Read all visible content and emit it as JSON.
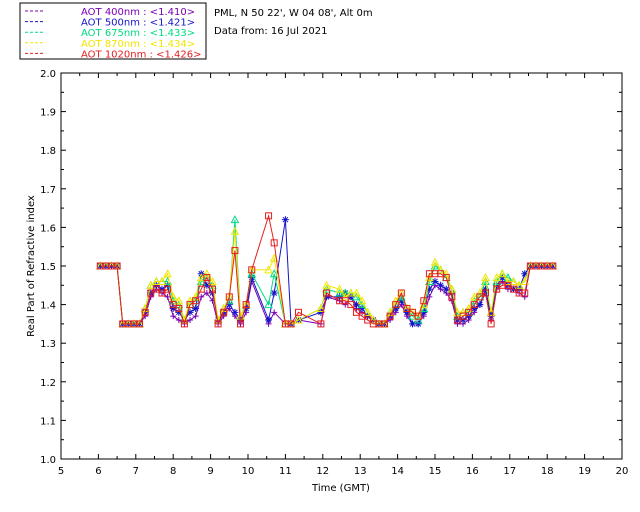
{
  "chart_data": {
    "type": "line",
    "info_lines": [
      "PML, N 50 22', W 04 08', Alt 0m",
      "Data from: 16 Jul 2021"
    ],
    "xlabel": "Time (GMT)",
    "ylabel": "Real Part of Refractive index",
    "xlim": [
      5,
      20
    ],
    "ylim": [
      1.0,
      2.0
    ],
    "xticks": [
      5,
      6,
      7,
      8,
      9,
      10,
      11,
      12,
      13,
      14,
      15,
      16,
      17,
      18,
      19,
      20
    ],
    "yticks": [
      "1.0",
      "1.1",
      "1.2",
      "1.3",
      "1.4",
      "1.5",
      "1.6",
      "1.7",
      "1.8",
      "1.9",
      "2.0"
    ],
    "grid": false,
    "legend_position": "top-left",
    "series": [
      {
        "name": "AOT 400nm : <1.410>",
        "color": "#7b00b4",
        "marker": "plus",
        "x": [
          6.05,
          6.2,
          6.35,
          6.5,
          6.65,
          6.8,
          6.95,
          7.1,
          7.25,
          7.4,
          7.55,
          7.7,
          7.85,
          8.0,
          8.15,
          8.3,
          8.45,
          8.6,
          8.75,
          8.9,
          9.05,
          9.2,
          9.35,
          9.5,
          9.65,
          9.8,
          9.95,
          10.1,
          10.55,
          10.7,
          11.0,
          11.15,
          11.35,
          11.95,
          12.1,
          12.45,
          12.6,
          12.75,
          12.9,
          13.05,
          13.2,
          13.35,
          13.5,
          13.65,
          13.8,
          13.95,
          14.1,
          14.25,
          14.4,
          14.55,
          14.7,
          14.85,
          15.0,
          15.15,
          15.3,
          15.45,
          15.6,
          15.75,
          15.9,
          16.05,
          16.2,
          16.35,
          16.5,
          16.65,
          16.8,
          16.95,
          17.1,
          17.25,
          17.4,
          17.55,
          17.7,
          17.85,
          18.0,
          18.15
        ],
        "y": [
          1.5,
          1.5,
          1.5,
          1.5,
          1.35,
          1.35,
          1.35,
          1.35,
          1.37,
          1.42,
          1.44,
          1.43,
          1.42,
          1.37,
          1.36,
          1.35,
          1.36,
          1.37,
          1.42,
          1.43,
          1.41,
          1.35,
          1.37,
          1.39,
          1.37,
          1.35,
          1.38,
          1.46,
          1.35,
          1.38,
          1.35,
          1.35,
          1.36,
          1.35,
          1.42,
          1.41,
          1.4,
          1.42,
          1.39,
          1.38,
          1.37,
          1.36,
          1.35,
          1.35,
          1.36,
          1.38,
          1.4,
          1.37,
          1.35,
          1.35,
          1.37,
          1.42,
          1.45,
          1.44,
          1.43,
          1.41,
          1.35,
          1.35,
          1.36,
          1.38,
          1.4,
          1.43,
          1.36,
          1.44,
          1.46,
          1.44,
          1.44,
          1.43,
          1.42,
          1.5,
          1.5,
          1.5,
          1.5,
          1.5
        ]
      },
      {
        "name": "AOT 500nm : <1.421>",
        "color": "#1414c8",
        "marker": "star",
        "x": [
          6.05,
          6.2,
          6.35,
          6.5,
          6.65,
          6.8,
          6.95,
          7.1,
          7.25,
          7.4,
          7.55,
          7.7,
          7.85,
          8.0,
          8.15,
          8.3,
          8.45,
          8.6,
          8.75,
          8.9,
          9.05,
          9.2,
          9.35,
          9.5,
          9.65,
          9.8,
          9.95,
          10.1,
          10.55,
          10.7,
          11.0,
          11.15,
          11.35,
          11.95,
          12.1,
          12.45,
          12.6,
          12.75,
          12.9,
          13.05,
          13.2,
          13.35,
          13.5,
          13.65,
          13.8,
          13.95,
          14.1,
          14.25,
          14.4,
          14.55,
          14.7,
          14.85,
          15.0,
          15.15,
          15.3,
          15.45,
          15.6,
          15.75,
          15.9,
          16.05,
          16.2,
          16.35,
          16.5,
          16.65,
          16.8,
          16.95,
          17.1,
          17.25,
          17.4,
          17.55,
          17.7,
          17.85,
          18.0,
          18.15
        ],
        "y": [
          1.5,
          1.5,
          1.5,
          1.5,
          1.35,
          1.35,
          1.35,
          1.35,
          1.38,
          1.43,
          1.45,
          1.44,
          1.45,
          1.39,
          1.38,
          1.36,
          1.38,
          1.39,
          1.48,
          1.45,
          1.43,
          1.36,
          1.38,
          1.4,
          1.38,
          1.36,
          1.39,
          1.47,
          1.36,
          1.43,
          1.62,
          1.35,
          1.36,
          1.38,
          1.42,
          1.42,
          1.43,
          1.42,
          1.4,
          1.39,
          1.37,
          1.36,
          1.35,
          1.35,
          1.37,
          1.39,
          1.41,
          1.38,
          1.35,
          1.35,
          1.38,
          1.44,
          1.46,
          1.45,
          1.44,
          1.43,
          1.36,
          1.36,
          1.37,
          1.39,
          1.4,
          1.44,
          1.37,
          1.45,
          1.47,
          1.45,
          1.44,
          1.44,
          1.48,
          1.5,
          1.5,
          1.5,
          1.5,
          1.5
        ]
      },
      {
        "name": "AOT 675nm : <1.433>",
        "color": "#00dc82",
        "marker": "triangle",
        "x": [
          6.05,
          6.2,
          6.35,
          6.5,
          6.65,
          6.8,
          6.95,
          7.1,
          7.25,
          7.4,
          7.55,
          7.7,
          7.85,
          8.0,
          8.15,
          8.3,
          8.45,
          8.6,
          8.75,
          8.9,
          9.05,
          9.2,
          9.35,
          9.5,
          9.65,
          9.8,
          9.95,
          10.1,
          10.55,
          10.7,
          11.0,
          11.15,
          11.35,
          11.95,
          12.1,
          12.45,
          12.6,
          12.75,
          12.9,
          13.05,
          13.2,
          13.35,
          13.5,
          13.65,
          13.8,
          13.95,
          14.1,
          14.25,
          14.4,
          14.55,
          14.7,
          14.85,
          15.0,
          15.15,
          15.3,
          15.45,
          15.6,
          15.75,
          15.9,
          16.05,
          16.2,
          16.35,
          16.5,
          16.65,
          16.8,
          16.95,
          17.1,
          17.25,
          17.4,
          17.55,
          17.7,
          17.85,
          18.0,
          18.15
        ],
        "y": [
          1.5,
          1.5,
          1.5,
          1.5,
          1.35,
          1.35,
          1.35,
          1.35,
          1.39,
          1.45,
          1.46,
          1.46,
          1.46,
          1.41,
          1.4,
          1.36,
          1.4,
          1.41,
          1.46,
          1.47,
          1.45,
          1.36,
          1.39,
          1.41,
          1.62,
          1.37,
          1.4,
          1.48,
          1.4,
          1.48,
          1.35,
          1.35,
          1.36,
          1.39,
          1.44,
          1.43,
          1.43,
          1.43,
          1.42,
          1.4,
          1.38,
          1.36,
          1.35,
          1.35,
          1.38,
          1.4,
          1.42,
          1.39,
          1.37,
          1.36,
          1.39,
          1.46,
          1.5,
          1.49,
          1.47,
          1.44,
          1.37,
          1.38,
          1.38,
          1.41,
          1.42,
          1.46,
          1.38,
          1.46,
          1.48,
          1.47,
          1.46,
          1.45,
          1.46,
          1.5,
          1.5,
          1.5,
          1.5,
          1.5
        ]
      },
      {
        "name": "AOT 870nm : <1.434>",
        "color": "#f0e600",
        "marker": "triangle",
        "x": [
          6.05,
          6.2,
          6.35,
          6.5,
          6.65,
          6.8,
          6.95,
          7.1,
          7.25,
          7.4,
          7.55,
          7.7,
          7.85,
          8.0,
          8.15,
          8.3,
          8.45,
          8.6,
          8.75,
          8.9,
          9.05,
          9.2,
          9.35,
          9.5,
          9.65,
          9.8,
          9.95,
          10.1,
          10.55,
          10.7,
          11.0,
          11.15,
          11.35,
          11.95,
          12.1,
          12.45,
          12.6,
          12.75,
          12.9,
          13.05,
          13.2,
          13.35,
          13.5,
          13.65,
          13.8,
          13.95,
          14.1,
          14.25,
          14.4,
          14.55,
          14.7,
          14.85,
          15.0,
          15.15,
          15.3,
          15.45,
          15.6,
          15.75,
          15.9,
          16.05,
          16.2,
          16.35,
          16.5,
          16.65,
          16.8,
          16.95,
          17.1,
          17.25,
          17.4,
          17.55,
          17.7,
          17.85,
          18.0,
          18.15
        ],
        "y": [
          1.5,
          1.5,
          1.5,
          1.5,
          1.35,
          1.35,
          1.35,
          1.35,
          1.39,
          1.45,
          1.46,
          1.46,
          1.48,
          1.42,
          1.41,
          1.36,
          1.41,
          1.42,
          1.47,
          1.48,
          1.46,
          1.36,
          1.39,
          1.42,
          1.59,
          1.37,
          1.4,
          1.49,
          1.49,
          1.52,
          1.35,
          1.35,
          1.36,
          1.39,
          1.45,
          1.44,
          1.42,
          1.43,
          1.43,
          1.41,
          1.38,
          1.36,
          1.35,
          1.35,
          1.38,
          1.41,
          1.43,
          1.39,
          1.38,
          1.37,
          1.4,
          1.47,
          1.51,
          1.49,
          1.48,
          1.44,
          1.38,
          1.38,
          1.39,
          1.42,
          1.43,
          1.47,
          1.38,
          1.47,
          1.48,
          1.46,
          1.46,
          1.45,
          1.46,
          1.5,
          1.5,
          1.5,
          1.5,
          1.5
        ]
      },
      {
        "name": "AOT 1020nm : <1.426>",
        "color": "#e61e1e",
        "marker": "square",
        "x": [
          6.05,
          6.2,
          6.35,
          6.5,
          6.65,
          6.8,
          6.95,
          7.1,
          7.25,
          7.4,
          7.55,
          7.7,
          7.85,
          8.0,
          8.15,
          8.3,
          8.45,
          8.6,
          8.75,
          8.9,
          9.05,
          9.2,
          9.35,
          9.5,
          9.65,
          9.8,
          9.95,
          10.1,
          10.55,
          10.7,
          11.0,
          11.15,
          11.35,
          11.95,
          12.1,
          12.45,
          12.6,
          12.75,
          12.9,
          13.05,
          13.2,
          13.35,
          13.5,
          13.65,
          13.8,
          13.95,
          14.1,
          14.25,
          14.4,
          14.55,
          14.7,
          14.85,
          15.0,
          15.15,
          15.3,
          15.45,
          15.6,
          15.75,
          15.9,
          16.05,
          16.2,
          16.35,
          16.5,
          16.65,
          16.8,
          16.95,
          17.1,
          17.25,
          17.4,
          17.55,
          17.7,
          17.85,
          18.0,
          18.15
        ],
        "y": [
          1.5,
          1.5,
          1.5,
          1.5,
          1.35,
          1.35,
          1.35,
          1.35,
          1.38,
          1.43,
          1.44,
          1.43,
          1.44,
          1.4,
          1.39,
          1.35,
          1.4,
          1.41,
          1.44,
          1.47,
          1.44,
          1.35,
          1.38,
          1.42,
          1.54,
          1.35,
          1.4,
          1.49,
          1.63,
          1.56,
          1.35,
          1.35,
          1.38,
          1.35,
          1.43,
          1.41,
          1.41,
          1.4,
          1.38,
          1.37,
          1.36,
          1.35,
          1.35,
          1.35,
          1.37,
          1.4,
          1.43,
          1.39,
          1.38,
          1.37,
          1.41,
          1.48,
          1.48,
          1.48,
          1.47,
          1.42,
          1.36,
          1.37,
          1.38,
          1.4,
          1.42,
          1.43,
          1.35,
          1.44,
          1.45,
          1.45,
          1.44,
          1.43,
          1.43,
          1.5,
          1.5,
          1.5,
          1.5,
          1.5
        ]
      }
    ]
  }
}
